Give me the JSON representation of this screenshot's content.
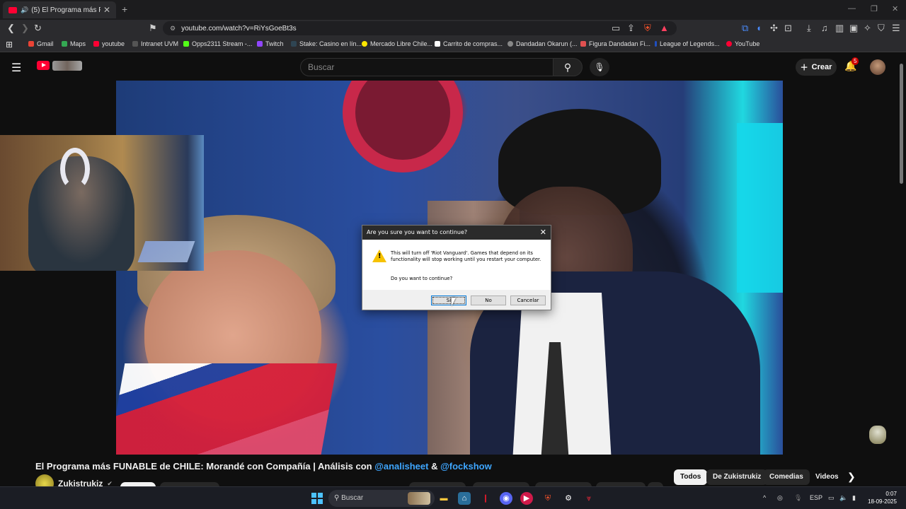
{
  "browser": {
    "tab_title": "(5) El Programa más FUNABLE",
    "new_tab": "+",
    "url": "youtube.com/watch?v=RiYsGoeBt3s",
    "bookmarks": [
      {
        "label": "Gmail",
        "color": "#ea4335"
      },
      {
        "label": "Maps",
        "color": "#34a853"
      },
      {
        "label": "youtube",
        "color": "#ff0033"
      },
      {
        "label": "Intranet UVM",
        "color": "#555555"
      },
      {
        "label": "Opps2311 Stream -...",
        "color": "#53fc18"
      },
      {
        "label": "Twitch",
        "color": "#9146ff"
      },
      {
        "label": "Stake: Casino en lín...",
        "color": "#1a2c38"
      },
      {
        "label": "Mercado Libre Chile...",
        "color": "#ffe600"
      },
      {
        "label": "Carrito de compras...",
        "color": "#ffffff"
      },
      {
        "label": "Dandadan Okarun (...",
        "color": "#888888"
      },
      {
        "label": "Figura Dandadan Fi...",
        "color": "#e05050"
      },
      {
        "label": "League of Legends...",
        "color": "#2050c0"
      },
      {
        "label": "YouTube",
        "color": "#ff0033"
      }
    ]
  },
  "youtube": {
    "search_placeholder": "Buscar",
    "create_label": "Crear",
    "notification_count": "5",
    "video_title_main": "El Programa más FUNABLE de CHILE: Morandé con Compañía | Análisis con ",
    "video_title_link1": "@analisheet",
    "video_title_amp": " & ",
    "video_title_link2": "@fockshow",
    "channel_name": "Zukistrukiz",
    "chips": [
      "Todos",
      "De Zukistrukiz",
      "Comedias",
      "Videos"
    ]
  },
  "dialog": {
    "title": "Are you sure you want to continue?",
    "message": "This will turn off 'Riot Vanguard'. Games that depend on its functionality will stop working until you restart your computer.",
    "question": "Do you want to continue?",
    "btn_yes": "Sí",
    "btn_no": "No",
    "btn_cancel": "Cancelar"
  },
  "taskbar": {
    "search_label": "Buscar",
    "language": "ESP",
    "time": "0:07",
    "date": "18-09-2025"
  }
}
